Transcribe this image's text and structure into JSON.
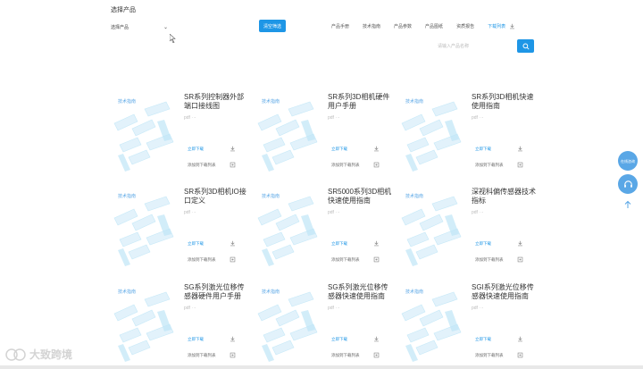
{
  "filter": {
    "title": "选择产品",
    "select_placeholder": "选择产品",
    "filter_button": "清空筛选"
  },
  "tabs": [
    {
      "label": "产品手册"
    },
    {
      "label": "技术指南"
    },
    {
      "label": "产品参数"
    },
    {
      "label": "产品图纸"
    },
    {
      "label": "资质报告"
    },
    {
      "label": "下载列表"
    }
  ],
  "search": {
    "placeholder": "请输入产品名称"
  },
  "cards": [
    {
      "tag": "技术指南",
      "title": "SR系列控制器外部端口接线图",
      "meta": "pdf · -",
      "download": "立即下载",
      "add": "添加到下载列表"
    },
    {
      "tag": "技术指南",
      "title": "SR系列3D相机硬件用户手册",
      "meta": "pdf · -",
      "download": "立即下载",
      "add": "添加到下载列表"
    },
    {
      "tag": "技术指南",
      "title": "SR系列3D相机快速使用指南",
      "meta": "pdf · -",
      "download": "立即下载",
      "add": "添加到下载列表"
    },
    {
      "tag": "技术指南",
      "title": "SR系列3D相机IO接口定义",
      "meta": "pdf · -",
      "download": "立即下载",
      "add": "添加到下载列表"
    },
    {
      "tag": "技术指南",
      "title": "SR5000系列3D相机快速使用指南",
      "meta": "pdf · -",
      "download": "立即下载",
      "add": "添加到下载列表"
    },
    {
      "tag": "技术指南",
      "title": "深视科偏传感器技术指标",
      "meta": "pdf · -",
      "download": "立即下载",
      "add": "添加到下载列表"
    },
    {
      "tag": "技术指南",
      "title": "SG系列激光位移传感器硬件用户手册",
      "meta": "pdf · -",
      "download": "立即下载",
      "add": "添加到下载列表"
    },
    {
      "tag": "技术指南",
      "title": "SG系列激光位移传感器快速使用指南",
      "meta": "pdf · -",
      "download": "立即下载",
      "add": "添加到下载列表"
    },
    {
      "tag": "技术指南",
      "title": "SGI系列激光位移传感器快速使用指南",
      "meta": "pdf · -",
      "download": "立即下载",
      "add": "添加到下载列表"
    }
  ],
  "float": {
    "contact_label": "在线咨询"
  },
  "watermark": {
    "text": "大致跨境"
  },
  "colors": {
    "accent": "#1e96e6",
    "float": "#5aa7e6"
  }
}
